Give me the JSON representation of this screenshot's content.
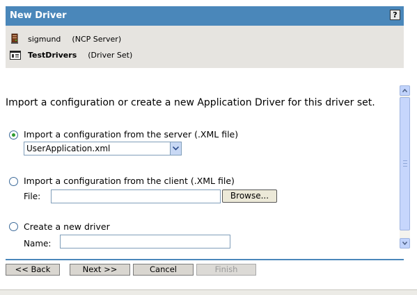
{
  "window": {
    "title": "New Driver",
    "help_label": "?"
  },
  "context": {
    "rows": [
      {
        "name": "sigmund",
        "type": "(NCP Server)",
        "icon": "server-icon"
      },
      {
        "name": "TestDrivers",
        "type": "(Driver Set)",
        "icon": "driver-set-icon"
      }
    ]
  },
  "form": {
    "intro": "Import a configuration or create a new Application Driver for this driver set.",
    "options": [
      {
        "label": "Import a configuration from the server (.XML file)",
        "checked": true
      },
      {
        "label": "Import a configuration from the client (.XML file)",
        "checked": false
      },
      {
        "label": "Create a new driver",
        "checked": false
      }
    ],
    "server_file": {
      "selected": "UserApplication.xml"
    },
    "client_file": {
      "label": "File:",
      "value": "",
      "browse_label": "Browse..."
    },
    "new_driver": {
      "label": "Name:",
      "value": ""
    }
  },
  "buttons": {
    "back": "<< Back",
    "next": "Next >>",
    "cancel": "Cancel",
    "finish": "Finish"
  },
  "colors": {
    "header": "#4a87ba",
    "context_bg": "#e6e4e0",
    "radio_dot": "#2e9b2e"
  }
}
